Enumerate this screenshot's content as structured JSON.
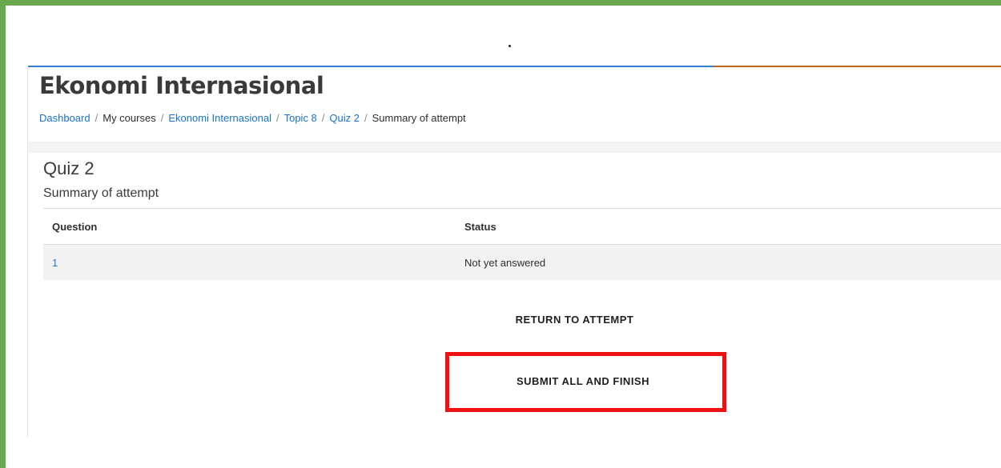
{
  "course": {
    "title": "Ekonomi Internasional"
  },
  "breadcrumb": {
    "items": [
      {
        "label": "Dashboard",
        "link": true
      },
      {
        "label": "My courses",
        "link": false
      },
      {
        "label": "Ekonomi Internasional",
        "link": true
      },
      {
        "label": "Topic 8",
        "link": true
      },
      {
        "label": "Quiz 2",
        "link": true
      },
      {
        "label": "Summary of attempt",
        "link": false
      }
    ],
    "separator": "/"
  },
  "quiz": {
    "title": "Quiz 2",
    "subtitle": "Summary of attempt"
  },
  "summary_table": {
    "headers": [
      "Question",
      "Status"
    ],
    "rows": [
      {
        "question": "1",
        "status": "Not yet answered"
      }
    ]
  },
  "actions": {
    "return_label": "RETURN TO ATTEMPT",
    "submit_label": "SUBMIT ALL AND FINISH"
  },
  "colors": {
    "frame": "#6aa84f",
    "accent_blue": "#2f7fd8",
    "accent_orange": "#c0651a",
    "link": "#1a73c8",
    "highlight": "#ee1111"
  }
}
